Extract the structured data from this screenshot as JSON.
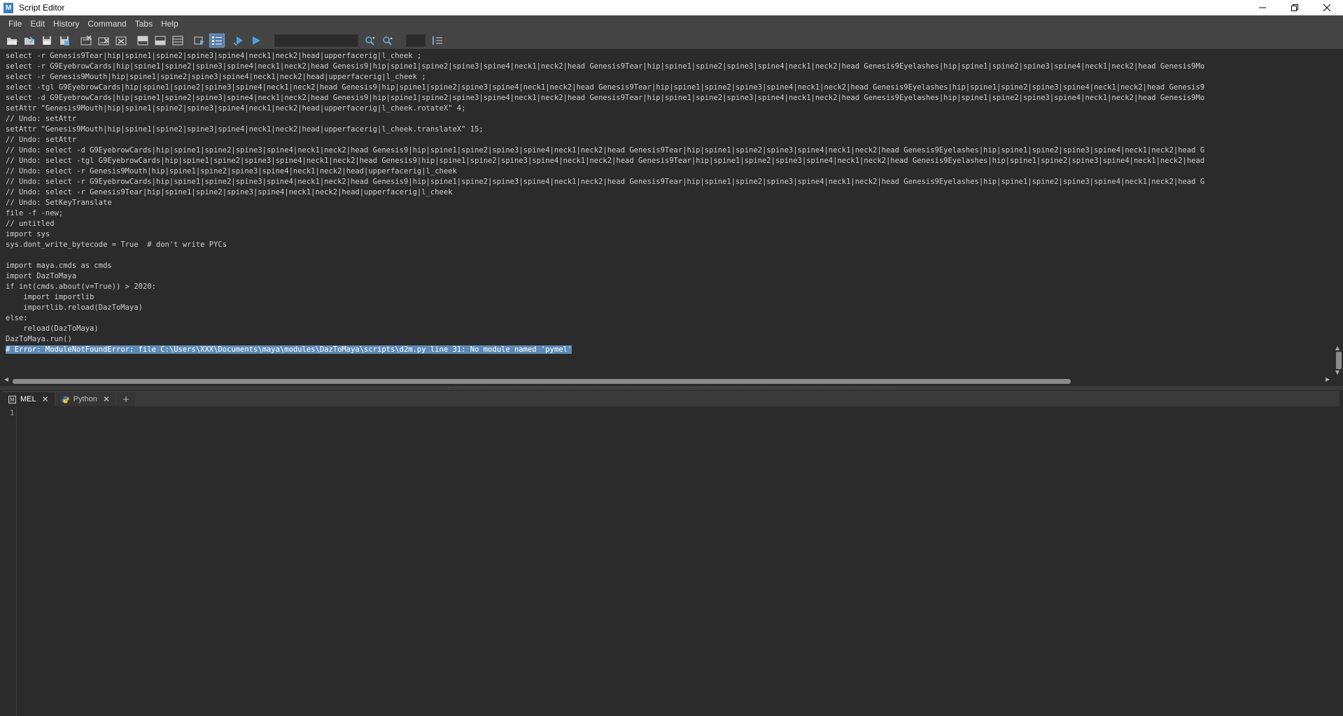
{
  "window": {
    "title": "Script Editor",
    "app_icon": "maya-icon"
  },
  "menu": [
    "File",
    "Edit",
    "History",
    "Command",
    "Tabs",
    "Help"
  ],
  "toolbar": {
    "buttons": [
      "open-script-icon",
      "source-script-icon",
      "save-script-icon",
      "save-to-shelf-icon",
      "clear-history-icon",
      "clear-input-icon",
      "clear-all-icon",
      "show-history-icon",
      "show-input-icon",
      "show-both-icon",
      "echo-all-commands-icon",
      "show-line-numbers-icon",
      "execute-all-icon",
      "execute-icon"
    ],
    "search_value": "",
    "goto_line_value": "",
    "search_icons": [
      "search-down-icon",
      "search-up-icon"
    ],
    "goto_icon": "goto-line-icon"
  },
  "history": {
    "lines": [
      "select -r Genesis9Tear|hip|spine1|spine2|spine3|spine4|neck1|neck2|head|upperfacerig|l_cheek ;",
      "select -r G9EyebrowCards|hip|spine1|spine2|spine3|spine4|neck1|neck2|head Genesis9|hip|spine1|spine2|spine3|spine4|neck1|neck2|head Genesis9Tear|hip|spine1|spine2|spine3|spine4|neck1|neck2|head Genesis9Eyelashes|hip|spine1|spine2|spine3|spine4|neck1|neck2|head Genesis9Mo",
      "select -r Genesis9Mouth|hip|spine1|spine2|spine3|spine4|neck1|neck2|head|upperfacerig|l_cheek ;",
      "select -tgl G9EyebrowCards|hip|spine1|spine2|spine3|spine4|neck1|neck2|head Genesis9|hip|spine1|spine2|spine3|spine4|neck1|neck2|head Genesis9Tear|hip|spine1|spine2|spine3|spine4|neck1|neck2|head Genesis9Eyelashes|hip|spine1|spine2|spine3|spine4|neck1|neck2|head Genesis9",
      "select -d G9EyebrowCards|hip|spine1|spine2|spine3|spine4|neck1|neck2|head Genesis9|hip|spine1|spine2|spine3|spine4|neck1|neck2|head Genesis9Tear|hip|spine1|spine2|spine3|spine4|neck1|neck2|head Genesis9Eyelashes|hip|spine1|spine2|spine3|spine4|neck1|neck2|head Genesis9Mo",
      "setAttr \"Genesis9Mouth|hip|spine1|spine2|spine3|spine4|neck1|neck2|head|upperfacerig|l_cheek.rotateX\" 4;",
      "// Undo: setAttr",
      "setAttr \"Genesis9Mouth|hip|spine1|spine2|spine3|spine4|neck1|neck2|head|upperfacerig|l_cheek.translateX\" 15;",
      "// Undo: setAttr",
      "// Undo: select -d G9EyebrowCards|hip|spine1|spine2|spine3|spine4|neck1|neck2|head Genesis9|hip|spine1|spine2|spine3|spine4|neck1|neck2|head Genesis9Tear|hip|spine1|spine2|spine3|spine4|neck1|neck2|head Genesis9Eyelashes|hip|spine1|spine2|spine3|spine4|neck1|neck2|head G",
      "// Undo: select -tgl G9EyebrowCards|hip|spine1|spine2|spine3|spine4|neck1|neck2|head Genesis9|hip|spine1|spine2|spine3|spine4|neck1|neck2|head Genesis9Tear|hip|spine1|spine2|spine3|spine4|neck1|neck2|head Genesis9Eyelashes|hip|spine1|spine2|spine3|spine4|neck1|neck2|head",
      "// Undo: select -r Genesis9Mouth|hip|spine1|spine2|spine3|spine4|neck1|neck2|head|upperfacerig|l_cheek",
      "// Undo: select -r G9EyebrowCards|hip|spine1|spine2|spine3|spine4|neck1|neck2|head Genesis9|hip|spine1|spine2|spine3|spine4|neck1|neck2|head Genesis9Tear|hip|spine1|spine2|spine3|spine4|neck1|neck2|head Genesis9Eyelashes|hip|spine1|spine2|spine3|spine4|neck1|neck2|head G",
      "// Undo: select -r Genesis9Tear|hip|spine1|spine2|spine3|spine4|neck1|neck2|head|upperfacerig|l_cheek",
      "// Undo: SetKeyTranslate",
      "file -f -new;",
      "// untitled",
      "import sys",
      "sys.dont_write_bytecode = True  # don't write PYCs",
      "",
      "import maya.cmds as cmds",
      "import DazToMaya",
      "if int(cmds.about(v=True)) > 2020:",
      "    import importlib",
      "    importlib.reload(DazToMaya)",
      "else:",
      "    reload(DazToMaya)",
      "DazToMaya.run()"
    ],
    "error_line": "# Error: ModuleNotFoundError: file C:\\Users\\XXX\\Documents\\maya\\modules\\DazToMaya\\scripts\\d2m.py line 31: No module named 'pymel'"
  },
  "tabs": [
    {
      "label": "MEL",
      "icon": "mel-icon",
      "active": true
    },
    {
      "label": "Python",
      "icon": "python-icon",
      "active": false
    }
  ],
  "add_tab_label": "+",
  "editor": {
    "line_numbers": [
      "1"
    ],
    "content": ""
  }
}
